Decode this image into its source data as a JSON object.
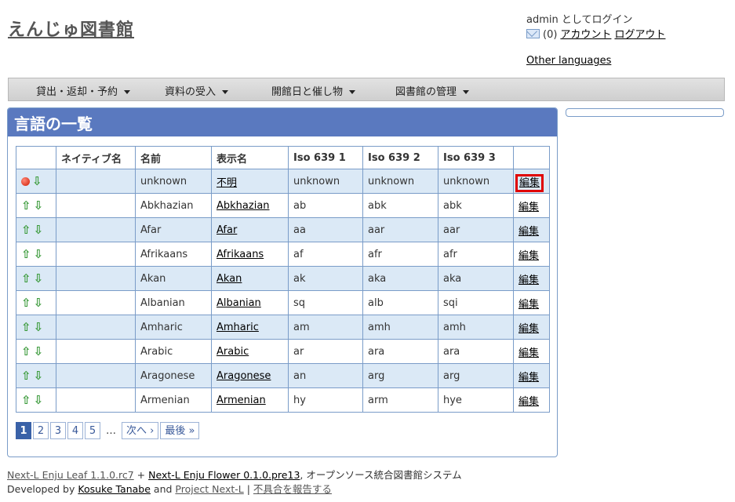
{
  "header": {
    "title": "えんじゅ図書館",
    "login_status": "admin としてログイン",
    "message_count": "(0)",
    "account_link": "アカウント",
    "logout_link": "ログアウト",
    "other_languages": "Other languages"
  },
  "menu": {
    "items": [
      "貸出・返却・予約",
      "資料の受入",
      "開館日と催し物",
      "図書館の管理"
    ]
  },
  "page": {
    "heading": "言語の一覧"
  },
  "table": {
    "headers": [
      "",
      "ネイティブ名",
      "名前",
      "表示名",
      "Iso 639 1",
      "Iso 639 2",
      "Iso 639 3",
      ""
    ],
    "edit_label": "編集",
    "rows": [
      {
        "native": "",
        "name": "unknown",
        "display": "不明",
        "iso1": "unknown",
        "iso2": "unknown",
        "iso3": "unknown"
      },
      {
        "native": "",
        "name": "Abkhazian",
        "display": "Abkhazian",
        "iso1": "ab",
        "iso2": "abk",
        "iso3": "abk"
      },
      {
        "native": "",
        "name": "Afar",
        "display": "Afar",
        "iso1": "aa",
        "iso2": "aar",
        "iso3": "aar"
      },
      {
        "native": "",
        "name": "Afrikaans",
        "display": "Afrikaans",
        "iso1": "af",
        "iso2": "afr",
        "iso3": "afr"
      },
      {
        "native": "",
        "name": "Akan",
        "display": "Akan",
        "iso1": "ak",
        "iso2": "aka",
        "iso3": "aka"
      },
      {
        "native": "",
        "name": "Albanian",
        "display": "Albanian",
        "iso1": "sq",
        "iso2": "alb",
        "iso3": "sqi"
      },
      {
        "native": "",
        "name": "Amharic",
        "display": "Amharic",
        "iso1": "am",
        "iso2": "amh",
        "iso3": "amh"
      },
      {
        "native": "",
        "name": "Arabic",
        "display": "Arabic",
        "iso1": "ar",
        "iso2": "ara",
        "iso3": "ara"
      },
      {
        "native": "",
        "name": "Aragonese",
        "display": "Aragonese",
        "iso1": "an",
        "iso2": "arg",
        "iso3": "arg"
      },
      {
        "native": "",
        "name": "Armenian",
        "display": "Armenian",
        "iso1": "hy",
        "iso2": "arm",
        "iso3": "hye"
      }
    ]
  },
  "pagination": {
    "pages": [
      "1",
      "2",
      "3",
      "4",
      "5"
    ],
    "current": "1",
    "ellipsis": "…",
    "next": "次へ ›",
    "last": "最後 »"
  },
  "footer": {
    "leaf": "Next-L Enju Leaf 1.1.0.rc7",
    "plus": " + ",
    "flower": "Next-L Enju Flower 0.1.0.pre13",
    "tagline": ", オープンソース統合図書館システム",
    "developed_by": "Developed by ",
    "author": "Kosuke Tanabe",
    "and": " and ",
    "project": "Project Next-L",
    "sep": " | ",
    "report": "不具合を報告する"
  }
}
